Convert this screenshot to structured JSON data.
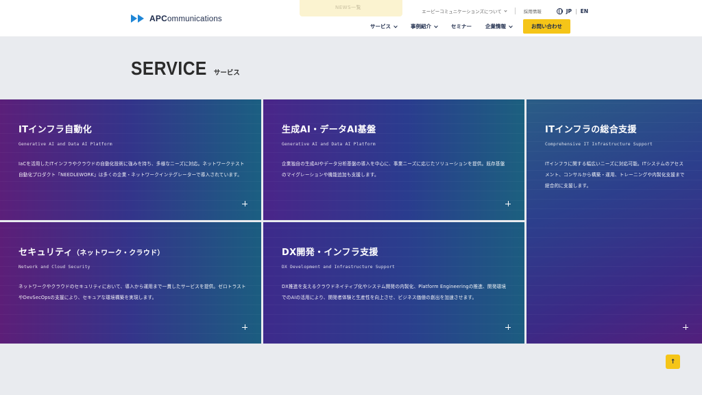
{
  "header": {
    "news_label": "NEWS一覧",
    "logo_text": "APCommunications",
    "logo_prefix": "APC",
    "logo_suffix": "ommunications",
    "util_nav": {
      "about": "エーピーコミュニケーションズについて",
      "recruit": "採用情報",
      "lang_jp": "JP",
      "lang_divider": "|",
      "lang_en": "EN"
    },
    "main_nav": [
      {
        "label": "サービス",
        "has_dropdown": true
      },
      {
        "label": "事例紹介",
        "has_dropdown": true
      },
      {
        "label": "セミナー",
        "has_dropdown": false
      },
      {
        "label": "企業情報",
        "has_dropdown": true
      }
    ],
    "contact": "お問い合わせ"
  },
  "section": {
    "title_en": "SERVICE",
    "title_ja": "サービス"
  },
  "cards": [
    {
      "title": "ITインフラ自動化",
      "subtitle": "Generative AI and Data AI Platform",
      "desc": "IaCを活用したITインフラやクラウドの自動化技術に強みを持ち、多様なニーズに対応。ネットワークテスト自動化プロダクト「NEEDLEWORK」は多くの企業・ネットワークインテグレーターで導入されています。"
    },
    {
      "title": "生成AI・データAI基盤",
      "subtitle": "Generative AI and Data AI Platform",
      "desc": "企業独自の生成AIやデータ分析基盤の導入を中心に、事業ニーズに応じたソリューションを提供。既存基盤のマイグレーションや機能追加も支援します。"
    },
    {
      "title": "ITインフラの総合支援",
      "subtitle": "Comprehensive IT Infrastructure Support",
      "desc": "ITインフラに関する幅広いニーズに対応可能。ITシステムのアセスメント、コンサルから構築・運用、トレーニングや内製化支援まで総合的に支援します。"
    },
    {
      "title": "セキュリティ",
      "title_small": "（ネットワーク・クラウド）",
      "subtitle": "Network and Cloud Security",
      "desc": "ネットワークやクラウドのセキュリティにおいて、導入から運用まで一貫したサービスを提供。ゼロトラストやDevSecOpsの支援により、セキュアな環境構築を実現します。"
    },
    {
      "title": "DX開発・インフラ支援",
      "subtitle": "DX Development and Infrastructure Support",
      "desc": "DX推進を支えるクラウドネイティブ化やシステム開発の内製化、Platform Engineeringの推進、開発環境でのAIの活用により、開発者体験と生産性を向上させ、ビジネス価値の創出を加速させます。"
    }
  ],
  "to_top": "↑",
  "colors": {
    "accent_yellow": "#f5c518",
    "logo_blue": "#1f86d6",
    "navy": "#1c2a4a"
  }
}
